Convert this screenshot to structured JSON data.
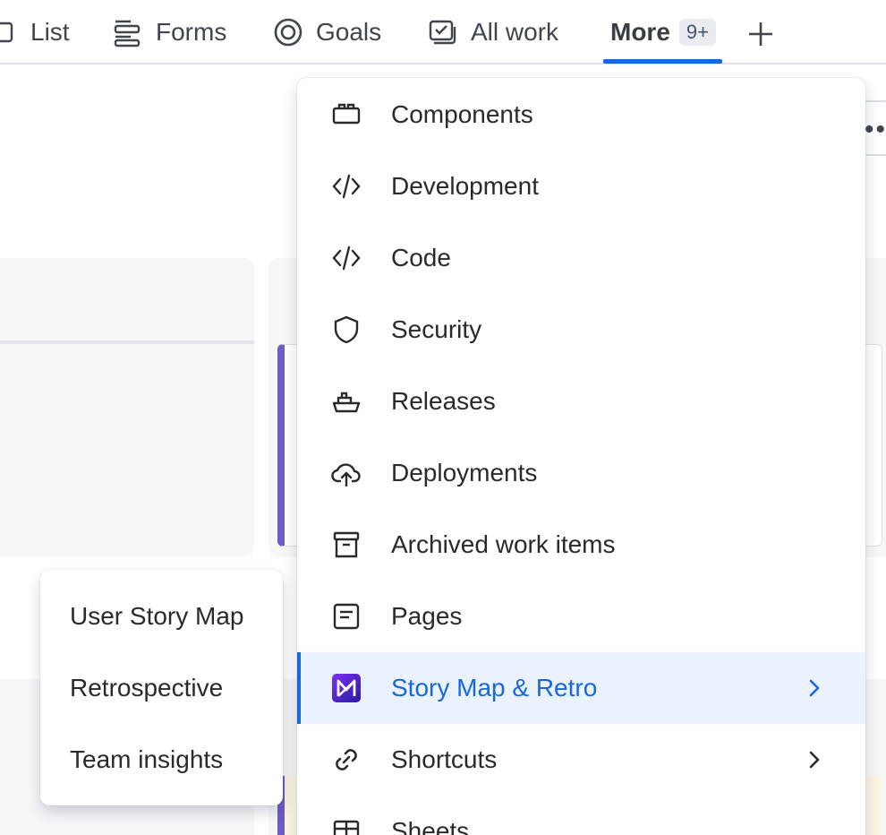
{
  "tabs": [
    {
      "label": "List",
      "icon": "list-icon"
    },
    {
      "label": "Forms",
      "icon": "forms-icon"
    },
    {
      "label": "Goals",
      "icon": "goals-icon"
    },
    {
      "label": "All work",
      "icon": "all-work-icon"
    }
  ],
  "more_tab": {
    "label": "More",
    "badge": "9+",
    "icon": "none"
  },
  "add_tab": {
    "icon": "plus-icon"
  },
  "background": {
    "more_actions": "••",
    "accent": "#6e5dc6"
  },
  "menu": {
    "items": [
      {
        "label": "Components",
        "icon": "components-icon"
      },
      {
        "label": "Development",
        "icon": "code-icon"
      },
      {
        "label": "Code",
        "icon": "code-icon"
      },
      {
        "label": "Security",
        "icon": "shield-icon"
      },
      {
        "label": "Releases",
        "icon": "ship-icon"
      },
      {
        "label": "Deployments",
        "icon": "cloud-upload-icon"
      },
      {
        "label": "Archived work items",
        "icon": "archive-icon"
      },
      {
        "label": "Pages",
        "icon": "page-icon"
      },
      {
        "label": "Story Map & Retro",
        "icon": "story-map-app-icon",
        "selected": true,
        "has_submenu": true
      },
      {
        "label": "Shortcuts",
        "icon": "link-icon",
        "has_submenu": true
      },
      {
        "label": "Sheets",
        "icon": "table-icon"
      }
    ]
  },
  "submenu": {
    "items": [
      {
        "label": "User Story Map"
      },
      {
        "label": "Retrospective"
      },
      {
        "label": "Team insights"
      }
    ]
  },
  "colors": {
    "accent_blue": "#1868db",
    "selected_bg": "#e9f2fe",
    "app_icon_purple": "#5b2bd9"
  }
}
